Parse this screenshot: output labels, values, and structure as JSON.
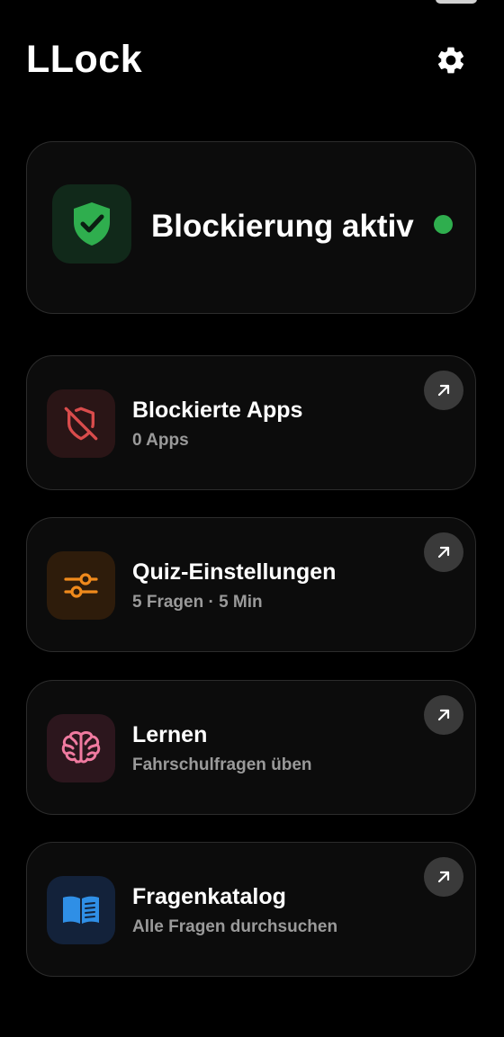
{
  "app": {
    "title": "LLock"
  },
  "header": {
    "settings_icon": "gear-icon"
  },
  "status": {
    "label": "Blockierung aktiv",
    "icon": "shield-check-icon",
    "active": true,
    "indicator_color": "#2fae4e"
  },
  "cards": [
    {
      "title": "Blockierte Apps",
      "subtitle": "0 Apps",
      "icon": "shield-off-icon",
      "accent": "#d94c4c"
    },
    {
      "title": "Quiz-Einstellungen",
      "subtitle": "5 Fragen · 5 Min",
      "icon": "sliders-icon",
      "accent": "#f08a1c"
    },
    {
      "title": "Lernen",
      "subtitle": "Fahrschulfragen üben",
      "icon": "brain-icon",
      "accent": "#f07aa0"
    },
    {
      "title": "Fragenkatalog",
      "subtitle": "Alle Fragen durchsuchen",
      "icon": "book-icon",
      "accent": "#2f8fe6"
    }
  ],
  "colors": {
    "background": "#000000",
    "card_background": "#0c0c0c",
    "card_border": "#2c2c2c",
    "subtitle_text": "#9a9a9a",
    "arrow_button": "#3a3a3a"
  }
}
